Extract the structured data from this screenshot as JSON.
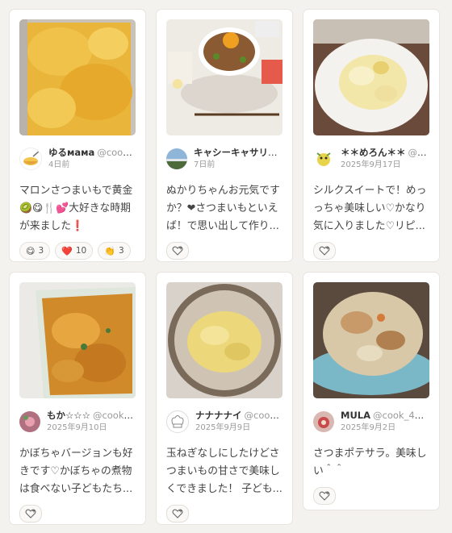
{
  "cards": [
    {
      "user_name": "ゆるмама",
      "user_handle": "@cook_4...",
      "date": "4日前",
      "text": "マロンさつまいもで黄金🥝😋🍴💕大好きな時期が来ました❗",
      "reactions": [
        {
          "emoji": "😋",
          "count": "3"
        },
        {
          "emoji": "❤️",
          "count": "10"
        },
        {
          "emoji": "👏",
          "count": "3"
        }
      ]
    },
    {
      "user_name": "キャシーキャサリン ...",
      "user_handle": "",
      "date": "7日前",
      "text": "ぬかりちゃんお元気ですか？❤さつまいもといえば！で思い出して作り...",
      "reactions": []
    },
    {
      "user_name": "＊＊めろん＊＊",
      "user_handle": "@coo...",
      "date": "2025年9月17日",
      "text": "シルクスイートで！めっっちゃ美味しい♡かなり気に入りました♡リピ...",
      "reactions": []
    },
    {
      "user_name": "もか☆☆☆",
      "user_handle": "@cook_...",
      "date": "2025年9月10日",
      "text": "かぼちゃバージョンも好きです♡かぼちゃの煮物は食べない子どもたち...",
      "reactions": []
    },
    {
      "user_name": "ナナナナイ",
      "user_handle": "@cook_4...",
      "date": "2025年9月9日",
      "text": "玉ねぎなしにしたけどさつまいもの甘さで美味しくできました！ 子ども...",
      "reactions": []
    },
    {
      "user_name": "MULA",
      "user_handle": "@cook_4004...",
      "date": "2025年9月2日",
      "text": "さつまポテサラ。美味しい＾＾",
      "reactions": []
    }
  ],
  "icons": {
    "like_button": "heart-plus-icon"
  },
  "colors": {
    "background": "#f4f2ee",
    "card": "#ffffff",
    "muted_text": "#999999"
  }
}
